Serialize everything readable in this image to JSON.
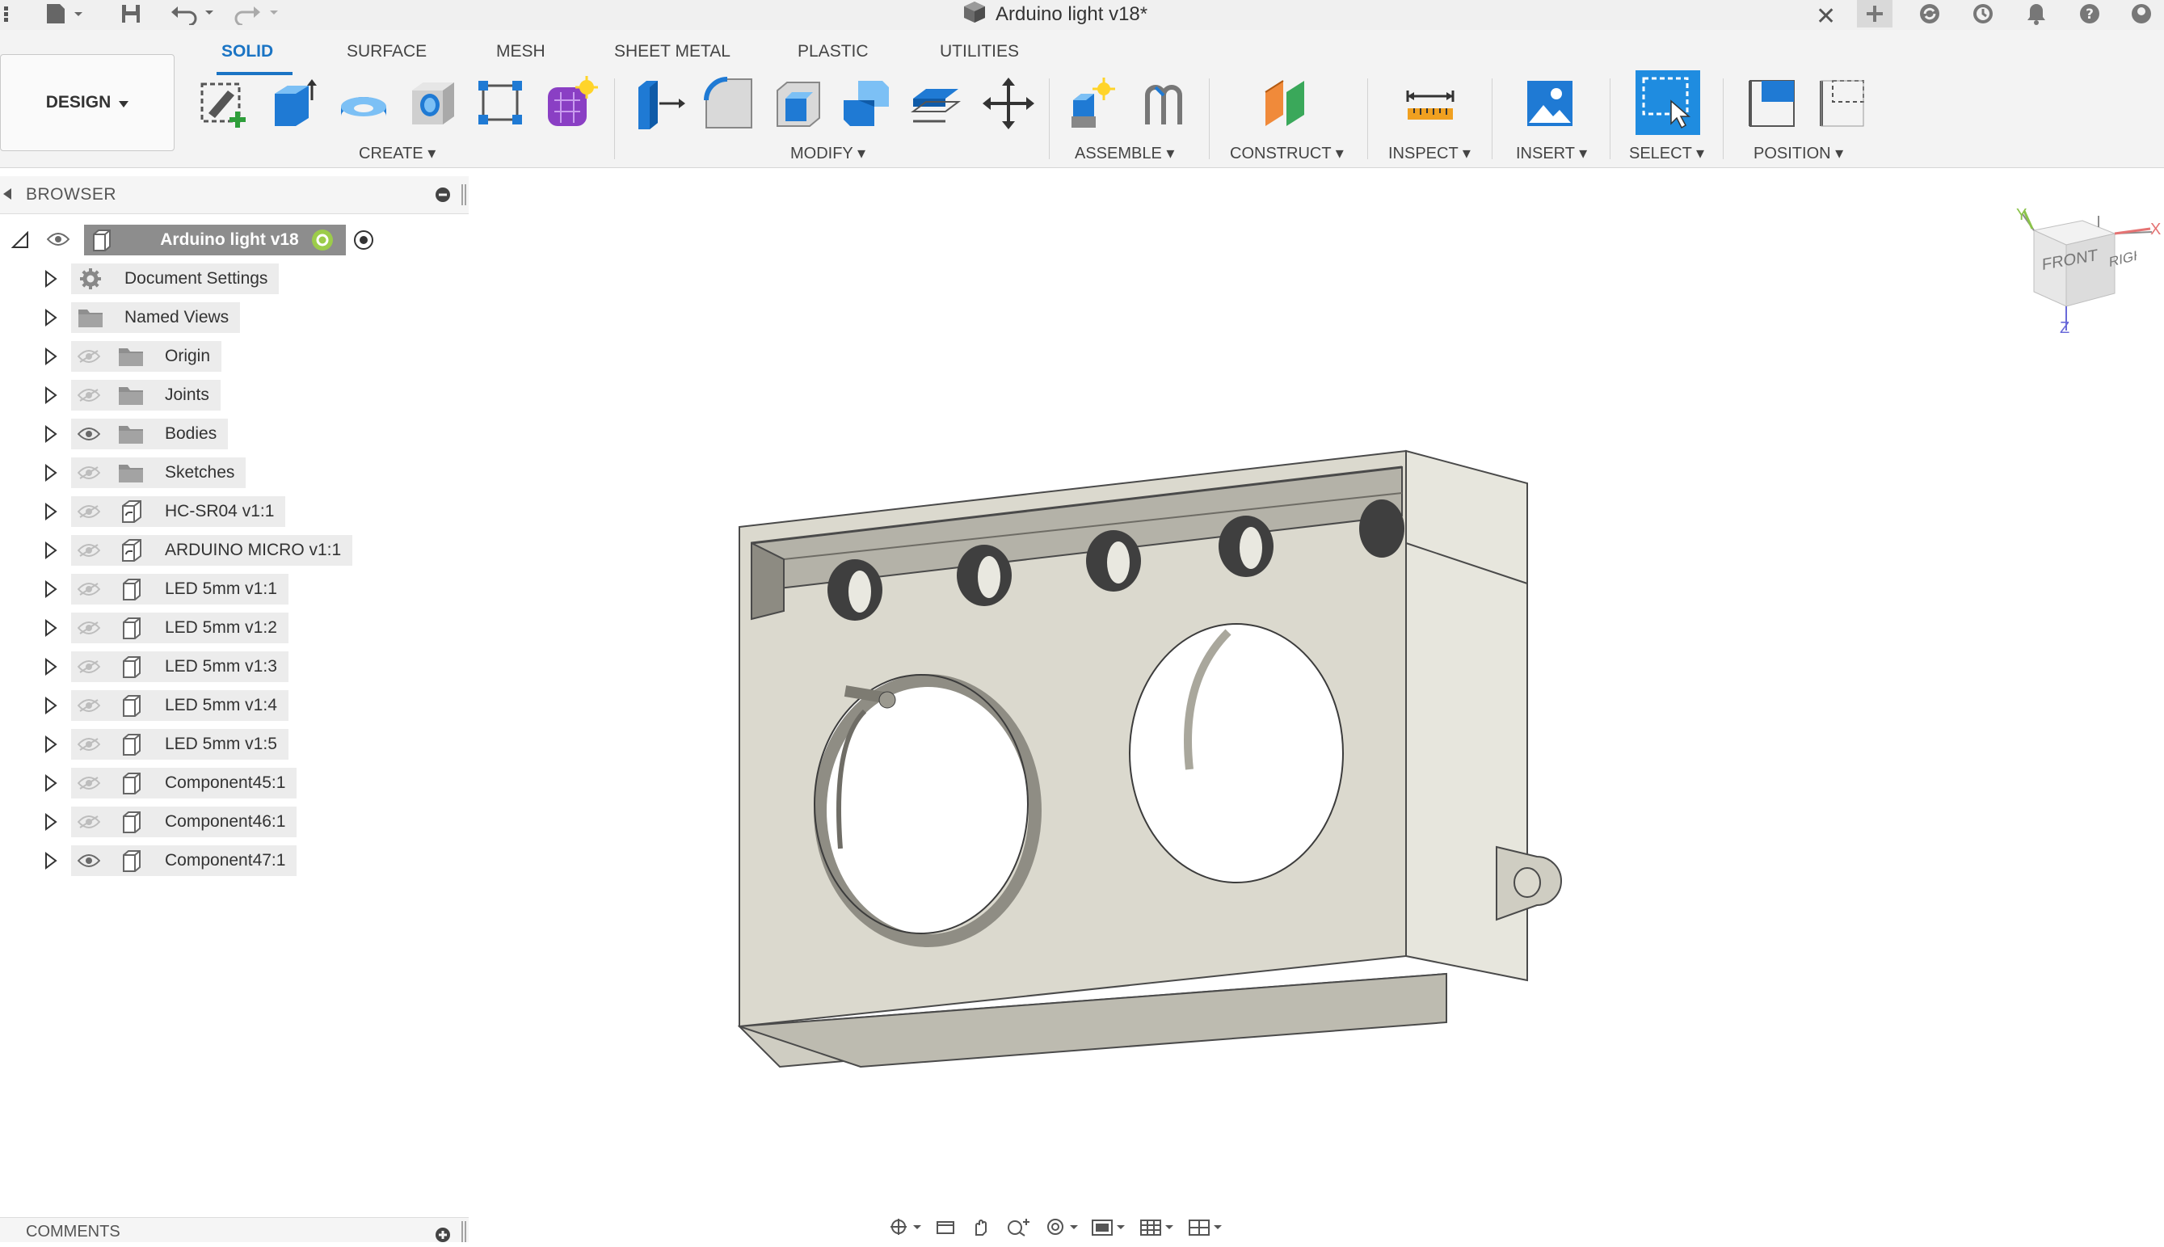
{
  "app": {
    "document_title": "Arduino light v18*",
    "close_glyph": "✕"
  },
  "titlebar_icons": [
    "grid-icon",
    "file-icon",
    "save-icon",
    "undo-icon",
    "redo-icon"
  ],
  "titlebar_right_icons": [
    "new-tab-icon",
    "sync-icon",
    "history-icon",
    "notifications-icon",
    "help-icon",
    "profile-icon"
  ],
  "workspace": {
    "label": "DESIGN"
  },
  "tabs": [
    {
      "label": "SOLID",
      "active": true
    },
    {
      "label": "SURFACE",
      "active": false
    },
    {
      "label": "MESH",
      "active": false
    },
    {
      "label": "SHEET METAL",
      "active": false
    },
    {
      "label": "PLASTIC",
      "active": false
    },
    {
      "label": "UTILITIES",
      "active": false
    }
  ],
  "tool_groups": [
    {
      "label": "CREATE",
      "tools": [
        "create-sketch",
        "extrude",
        "revolve",
        "hole",
        "pattern",
        "create-form"
      ]
    },
    {
      "label": "MODIFY",
      "tools": [
        "press-pull",
        "fillet",
        "shell",
        "combine",
        "offset-face",
        "move"
      ]
    },
    {
      "label": "ASSEMBLE",
      "tools": [
        "new-component",
        "joint"
      ]
    },
    {
      "label": "CONSTRUCT",
      "tools": [
        "offset-plane"
      ]
    },
    {
      "label": "INSPECT",
      "tools": [
        "measure"
      ]
    },
    {
      "label": "INSERT",
      "tools": [
        "insert-canvas"
      ]
    },
    {
      "label": "SELECT",
      "tools": [
        "select"
      ]
    },
    {
      "label": "POSITION",
      "tools": [
        "capture-position",
        "revert-position"
      ]
    }
  ],
  "browser": {
    "title": "BROWSER",
    "root": {
      "label": "Arduino light v18"
    },
    "items": [
      {
        "label": "Document Settings",
        "icon": "gear-icon",
        "eye": "none"
      },
      {
        "label": "Named Views",
        "icon": "folder-icon",
        "eye": "none"
      },
      {
        "label": "Origin",
        "icon": "folder-icon",
        "eye": "hidden"
      },
      {
        "label": "Joints",
        "icon": "folder-icon",
        "eye": "hidden"
      },
      {
        "label": "Bodies",
        "icon": "folder-icon",
        "eye": "visible"
      },
      {
        "label": "Sketches",
        "icon": "folder-icon",
        "eye": "hidden"
      },
      {
        "label": "HC-SR04 v1:1",
        "icon": "linked-component-icon",
        "eye": "hidden"
      },
      {
        "label": "ARDUINO MICRO v1:1",
        "icon": "linked-component-icon",
        "eye": "hidden"
      },
      {
        "label": "LED 5mm v1:1",
        "icon": "component-icon",
        "eye": "hidden"
      },
      {
        "label": "LED 5mm v1:2",
        "icon": "component-icon",
        "eye": "hidden"
      },
      {
        "label": "LED 5mm v1:3",
        "icon": "component-icon",
        "eye": "hidden"
      },
      {
        "label": "LED 5mm v1:4",
        "icon": "component-icon",
        "eye": "hidden"
      },
      {
        "label": "LED 5mm v1:5",
        "icon": "component-icon",
        "eye": "hidden"
      },
      {
        "label": "Component45:1",
        "icon": "component-icon",
        "eye": "hidden"
      },
      {
        "label": "Component46:1",
        "icon": "component-icon",
        "eye": "hidden"
      },
      {
        "label": "Component47:1",
        "icon": "component-icon",
        "eye": "visible"
      }
    ]
  },
  "comments": {
    "title": "COMMENTS"
  },
  "viewcube": {
    "front": "FRONT",
    "right": "RIGHT",
    "axis_x": "X",
    "axis_y": "Y",
    "axis_z": "Z"
  },
  "bottom_tools": [
    "orbit-icon",
    "look-at-icon",
    "pan-icon",
    "zoom-icon",
    "fit-icon",
    "display-settings-icon",
    "grid-settings-icon",
    "viewports-icon"
  ]
}
